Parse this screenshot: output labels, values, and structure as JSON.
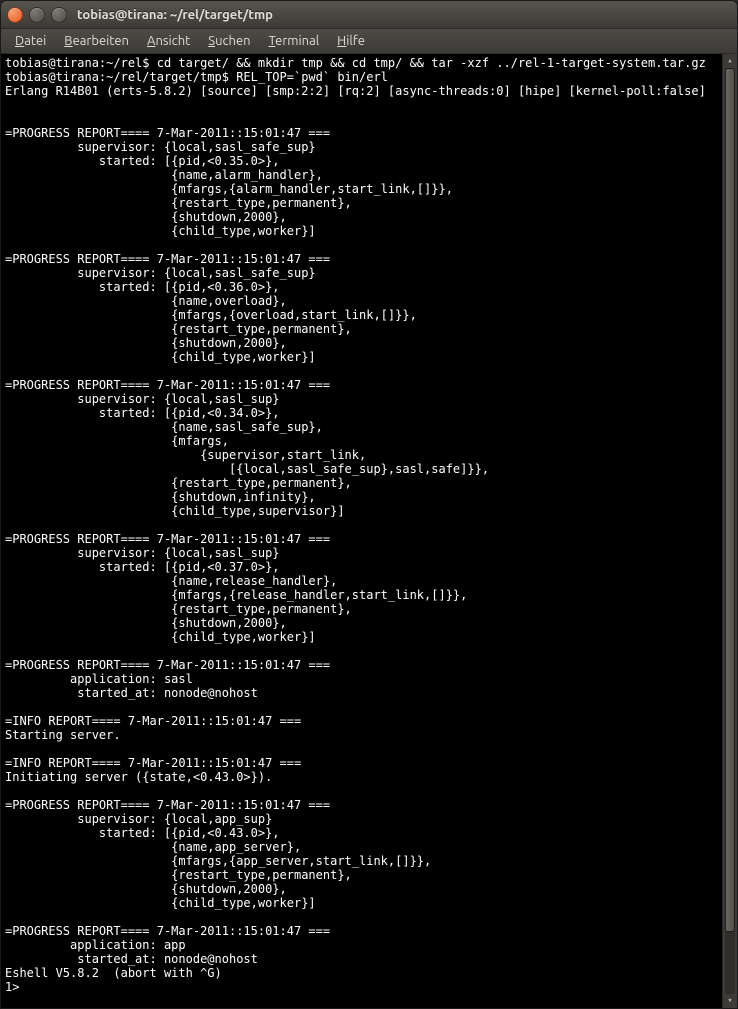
{
  "window": {
    "title": "tobias@tirana: ~/rel/target/tmp"
  },
  "menubar": {
    "items": [
      {
        "label": "Datei",
        "underline": "D"
      },
      {
        "label": "Bearbeiten",
        "underline": "B"
      },
      {
        "label": "Ansicht",
        "underline": "A"
      },
      {
        "label": "Suchen",
        "underline": "S"
      },
      {
        "label": "Terminal",
        "underline": "T"
      },
      {
        "label": "Hilfe",
        "underline": "H"
      }
    ]
  },
  "terminal": {
    "lines": [
      "tobias@tirana:~/rel$ cd target/ && mkdir tmp && cd tmp/ && tar -xzf ../rel-1-target-system.tar.gz",
      "tobias@tirana:~/rel/target/tmp$ REL_TOP=`pwd` bin/erl",
      "Erlang R14B01 (erts-5.8.2) [source] [smp:2:2] [rq:2] [async-threads:0] [hipe] [kernel-poll:false]",
      "",
      "",
      "=PROGRESS REPORT==== 7-Mar-2011::15:01:47 ===",
      "          supervisor: {local,sasl_safe_sup}",
      "             started: [{pid,<0.35.0>},",
      "                       {name,alarm_handler},",
      "                       {mfargs,{alarm_handler,start_link,[]}},",
      "                       {restart_type,permanent},",
      "                       {shutdown,2000},",
      "                       {child_type,worker}]",
      "",
      "=PROGRESS REPORT==== 7-Mar-2011::15:01:47 ===",
      "          supervisor: {local,sasl_safe_sup}",
      "             started: [{pid,<0.36.0>},",
      "                       {name,overload},",
      "                       {mfargs,{overload,start_link,[]}},",
      "                       {restart_type,permanent},",
      "                       {shutdown,2000},",
      "                       {child_type,worker}]",
      "",
      "=PROGRESS REPORT==== 7-Mar-2011::15:01:47 ===",
      "          supervisor: {local,sasl_sup}",
      "             started: [{pid,<0.34.0>},",
      "                       {name,sasl_safe_sup},",
      "                       {mfargs,",
      "                           {supervisor,start_link,",
      "                               [{local,sasl_safe_sup},sasl,safe]}},",
      "                       {restart_type,permanent},",
      "                       {shutdown,infinity},",
      "                       {child_type,supervisor}]",
      "",
      "=PROGRESS REPORT==== 7-Mar-2011::15:01:47 ===",
      "          supervisor: {local,sasl_sup}",
      "             started: [{pid,<0.37.0>},",
      "                       {name,release_handler},",
      "                       {mfargs,{release_handler,start_link,[]}},",
      "                       {restart_type,permanent},",
      "                       {shutdown,2000},",
      "                       {child_type,worker}]",
      "",
      "=PROGRESS REPORT==== 7-Mar-2011::15:01:47 ===",
      "         application: sasl",
      "          started_at: nonode@nohost",
      "",
      "=INFO REPORT==== 7-Mar-2011::15:01:47 ===",
      "Starting server.",
      "",
      "=INFO REPORT==== 7-Mar-2011::15:01:47 ===",
      "Initiating server ({state,<0.43.0>}).",
      "",
      "=PROGRESS REPORT==== 7-Mar-2011::15:01:47 ===",
      "          supervisor: {local,app_sup}",
      "             started: [{pid,<0.43.0>},",
      "                       {name,app_server},",
      "                       {mfargs,{app_server,start_link,[]}},",
      "                       {restart_type,permanent},",
      "                       {shutdown,2000},",
      "                       {child_type,worker}]",
      "",
      "=PROGRESS REPORT==== 7-Mar-2011::15:01:47 ===",
      "         application: app",
      "          started_at: nonode@nohost",
      "Eshell V5.8.2  (abort with ^G)",
      "1>"
    ]
  }
}
